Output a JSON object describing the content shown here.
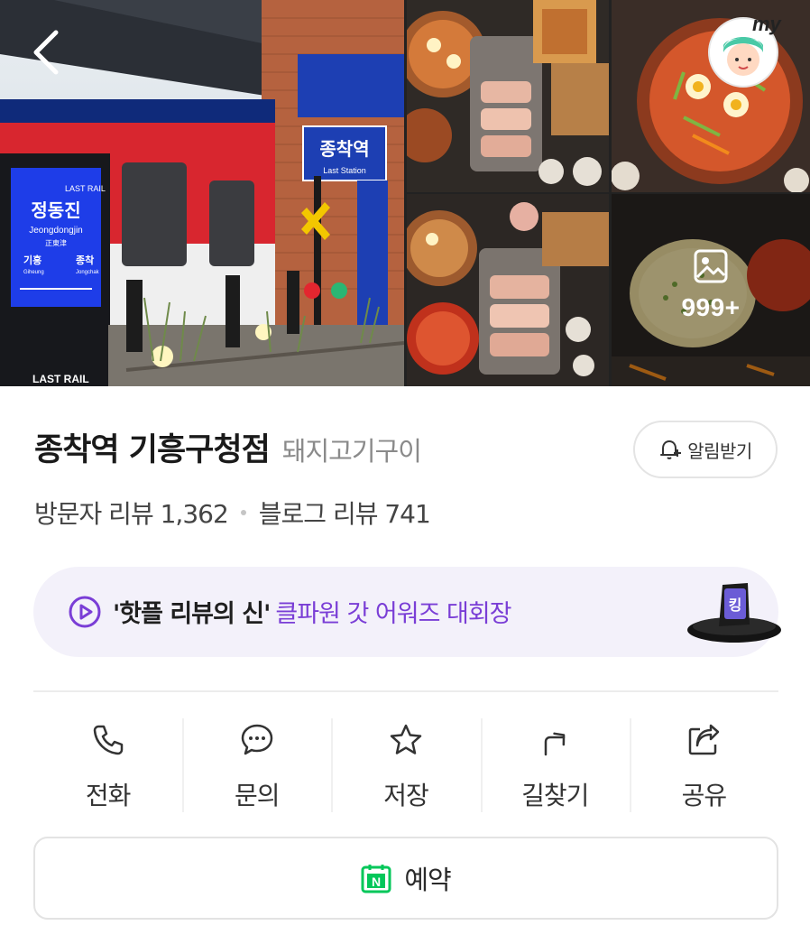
{
  "gallery": {
    "main_photo": "Station-themed storefront",
    "sign_station": "종착역",
    "sign_station_sub": "Last Station",
    "board_brand": "LAST RAIL",
    "board_station": "정동진",
    "board_station_en": "Jeongdongjin",
    "board_station_hanja": "正東津",
    "board_left": "기흥",
    "board_left_en": "Giheung",
    "board_right": "종착",
    "board_right_en": "Jongchak",
    "footer_brand": "LAST RAIL",
    "more_count": "999+"
  },
  "header": {
    "back_icon": "chevron-left-icon",
    "my_badge": "my"
  },
  "place": {
    "name": "종착역 기흥구청점",
    "category": "돼지고기구이",
    "alarm_label": "알림받기",
    "visitor_review_label": "방문자 리뷰 1,362",
    "blog_review_label": "블로그 리뷰 741"
  },
  "promo": {
    "strong_text": "'핫플 리뷰의 신'",
    "accent_text": "클파원 갓 어워즈 대회장",
    "hat_glyph": "킹",
    "accent_color": "#7a3ed6",
    "bg_color": "#f3f1fa"
  },
  "actions": [
    {
      "label": "전화",
      "icon": "phone-icon"
    },
    {
      "label": "문의",
      "icon": "chat-bubble-icon"
    },
    {
      "label": "저장",
      "icon": "star-icon"
    },
    {
      "label": "길찾기",
      "icon": "directions-icon"
    },
    {
      "label": "공유",
      "icon": "share-icon"
    }
  ],
  "reserve": {
    "label": "예약",
    "icon": "naver-calendar-icon",
    "icon_letter": "N",
    "icon_color": "#03c75a"
  }
}
